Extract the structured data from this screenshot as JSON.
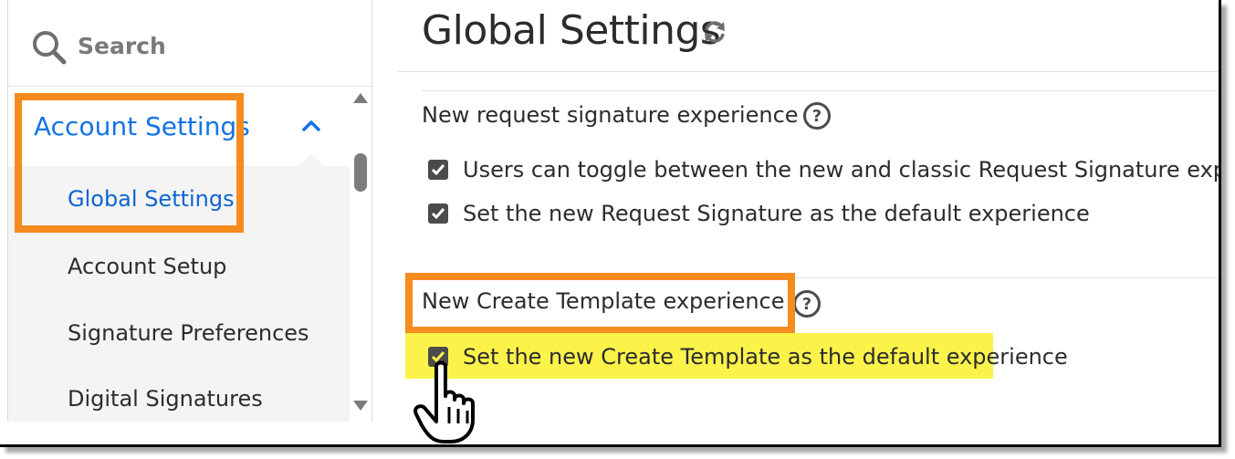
{
  "search": {
    "placeholder": "Search"
  },
  "sidebar": {
    "section_label": "Account Settings",
    "items": [
      {
        "label": "Global Settings",
        "active": true
      },
      {
        "label": "Account Setup",
        "active": false
      },
      {
        "label": "Signature Preferences",
        "active": false
      },
      {
        "label": "Digital Signatures",
        "active": false
      }
    ]
  },
  "main": {
    "title": "Global Settings",
    "sections": [
      {
        "title": "New request signature experience",
        "options": [
          {
            "label": "Users can toggle between the new and classic Request Signature experiences",
            "checked": true
          },
          {
            "label": "Set the new Request Signature as the default experience",
            "checked": true
          }
        ]
      },
      {
        "title": "New Create Template experience",
        "options": [
          {
            "label": "Set the new Create Template as the default experience",
            "checked": true
          }
        ]
      }
    ],
    "help_glyph": "?"
  },
  "colors": {
    "accent_blue": "#1473e6",
    "highlight_orange": "#f68b1e",
    "highlight_yellow": "#fbf34a"
  }
}
